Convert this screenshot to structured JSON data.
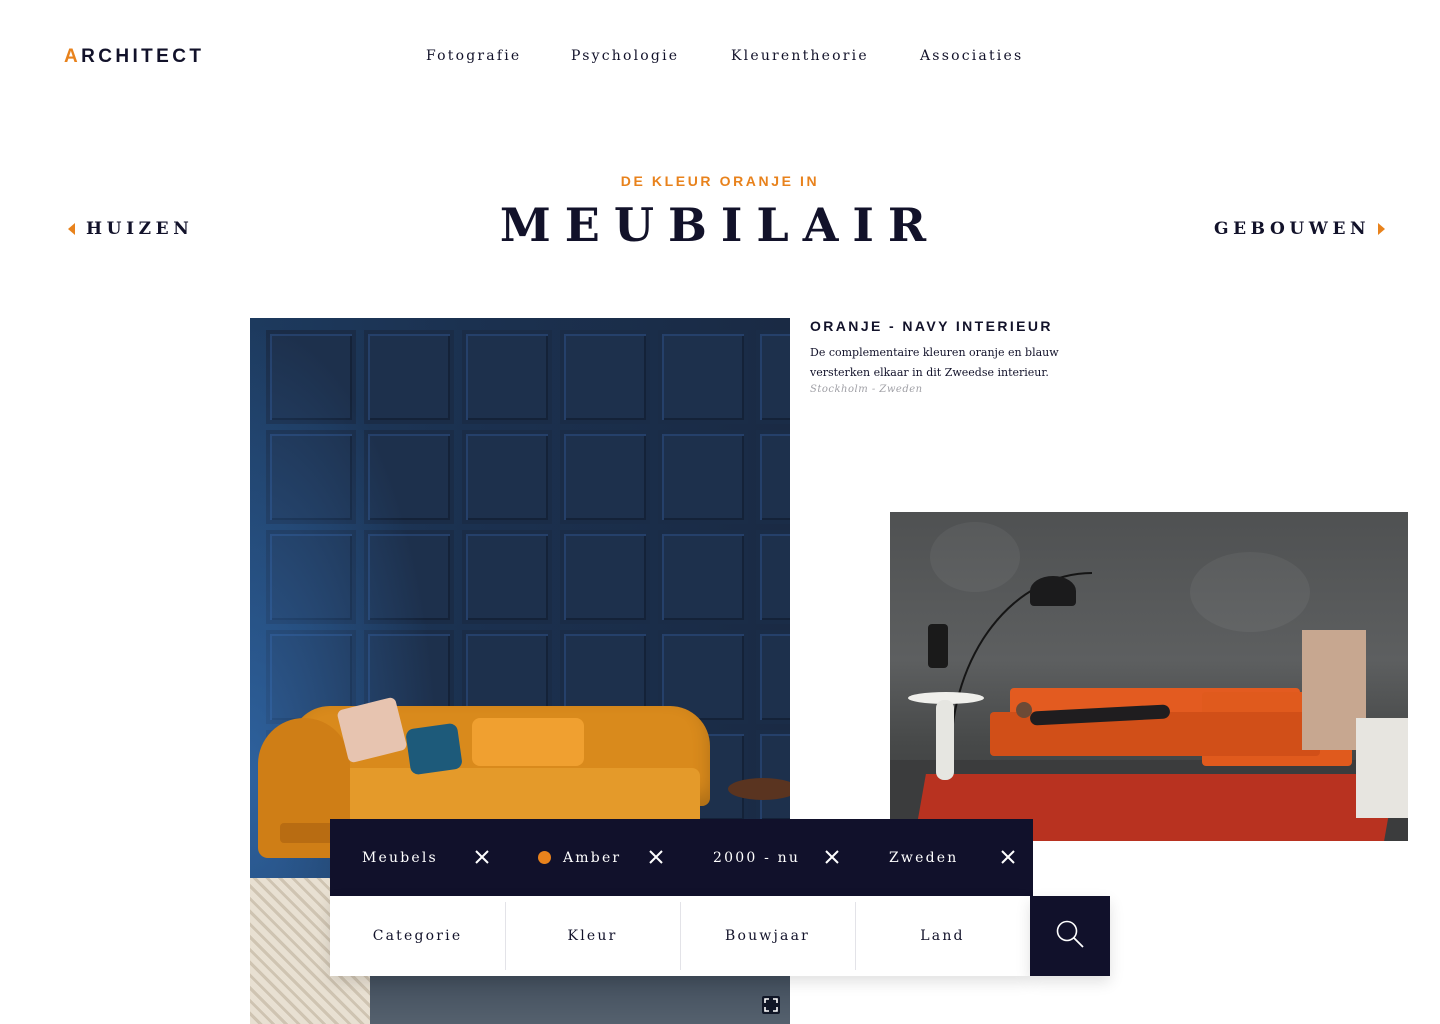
{
  "header": {
    "logo_initial": "A",
    "logo_rest": "RCHITECT",
    "nav": [
      "Fotografie",
      "Psychologie",
      "Kleurentheorie",
      "Associaties"
    ]
  },
  "hero": {
    "kicker": "DE KLEUR ORANJE IN",
    "title": "MEUBILAIR",
    "prev_label": "HUIZEN",
    "next_label": "GEBOUWEN"
  },
  "caption": {
    "title": "ORANJE - NAVY INTERIEUR",
    "text": "De complementaire kleuren oranje en blauw versterken elkaar in dit Zweedse interieur.",
    "location": "Stockholm - Zweden"
  },
  "filters": {
    "active": [
      {
        "label": "Meubels",
        "color": null
      },
      {
        "label": "Amber",
        "color": "#e8821c"
      },
      {
        "label": "2000 - nu",
        "color": null
      },
      {
        "label": "Zweden",
        "color": null
      }
    ],
    "selectors": [
      "Categorie",
      "Kleur",
      "Bouwjaar",
      "Land"
    ],
    "search_icon": "search-icon"
  },
  "colors": {
    "accent": "#e8821c",
    "navy": "#11112b"
  }
}
